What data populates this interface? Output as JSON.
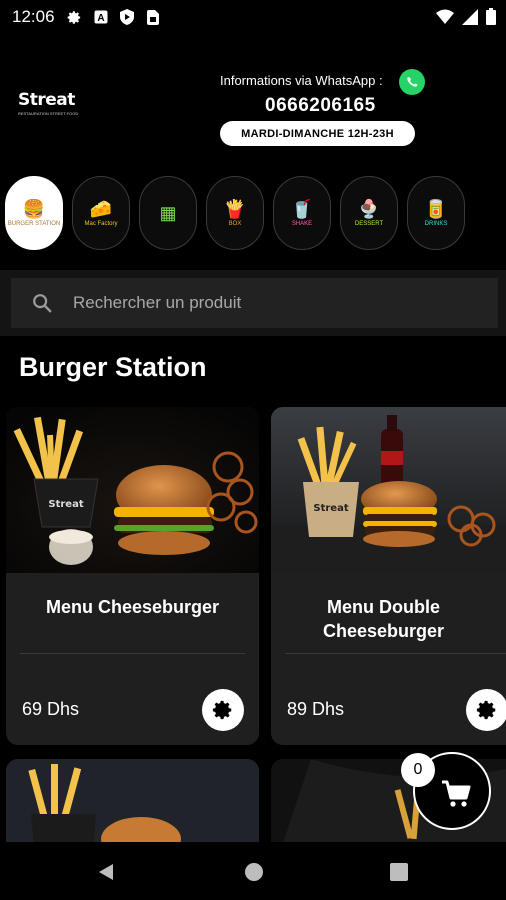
{
  "status_bar": {
    "time": "12:06",
    "left_icons": [
      "gear-icon",
      "a-notification-icon",
      "shield-play-icon",
      "sim-card-icon"
    ],
    "right_icons": [
      "wifi-icon",
      "cellular-signal-icon",
      "battery-icon"
    ]
  },
  "header": {
    "logo_text": "Streat",
    "logo_subtitle": "RESTAURATION STREET FOOD",
    "whatsapp_label": "Informations via WhatsApp :",
    "phone": "0666206165",
    "hours": "MARDI-DIMANCHE 12H-23H"
  },
  "categories": [
    {
      "icon": "burger-station-icon",
      "caption": "BURGER STATION",
      "color": "#c9a56a",
      "active": true
    },
    {
      "icon": "mac-factory-icon",
      "caption": "Mac Factory",
      "color": "#f2c230",
      "active": false
    },
    {
      "icon": "nachos-icon",
      "caption": "",
      "color": "#7ed957",
      "active": false
    },
    {
      "icon": "fries-box-icon",
      "caption": "BOX",
      "color": "#f2a516",
      "active": false
    },
    {
      "icon": "milkshake-icon",
      "caption": "SHAKE",
      "color": "#ff5fb0",
      "active": false
    },
    {
      "icon": "dessert-cup-icon",
      "caption": "DESSERT",
      "color": "#b6f23a",
      "active": false
    },
    {
      "icon": "drink-can-icon",
      "caption": "DRINKS",
      "color": "#35e0e0",
      "active": false
    }
  ],
  "search": {
    "placeholder": "Rechercher un produit"
  },
  "section": {
    "title": "Burger Station"
  },
  "products": [
    {
      "name": "Menu Cheeseburger",
      "price": "69 Dhs"
    },
    {
      "name": "Menu Double Cheeseburger",
      "price": "89 Dhs"
    }
  ],
  "cart": {
    "count": "0"
  },
  "colors": {
    "background": "#000000",
    "card": "#1f1f1f",
    "search": "#222222",
    "whatsapp": "#25D366"
  }
}
